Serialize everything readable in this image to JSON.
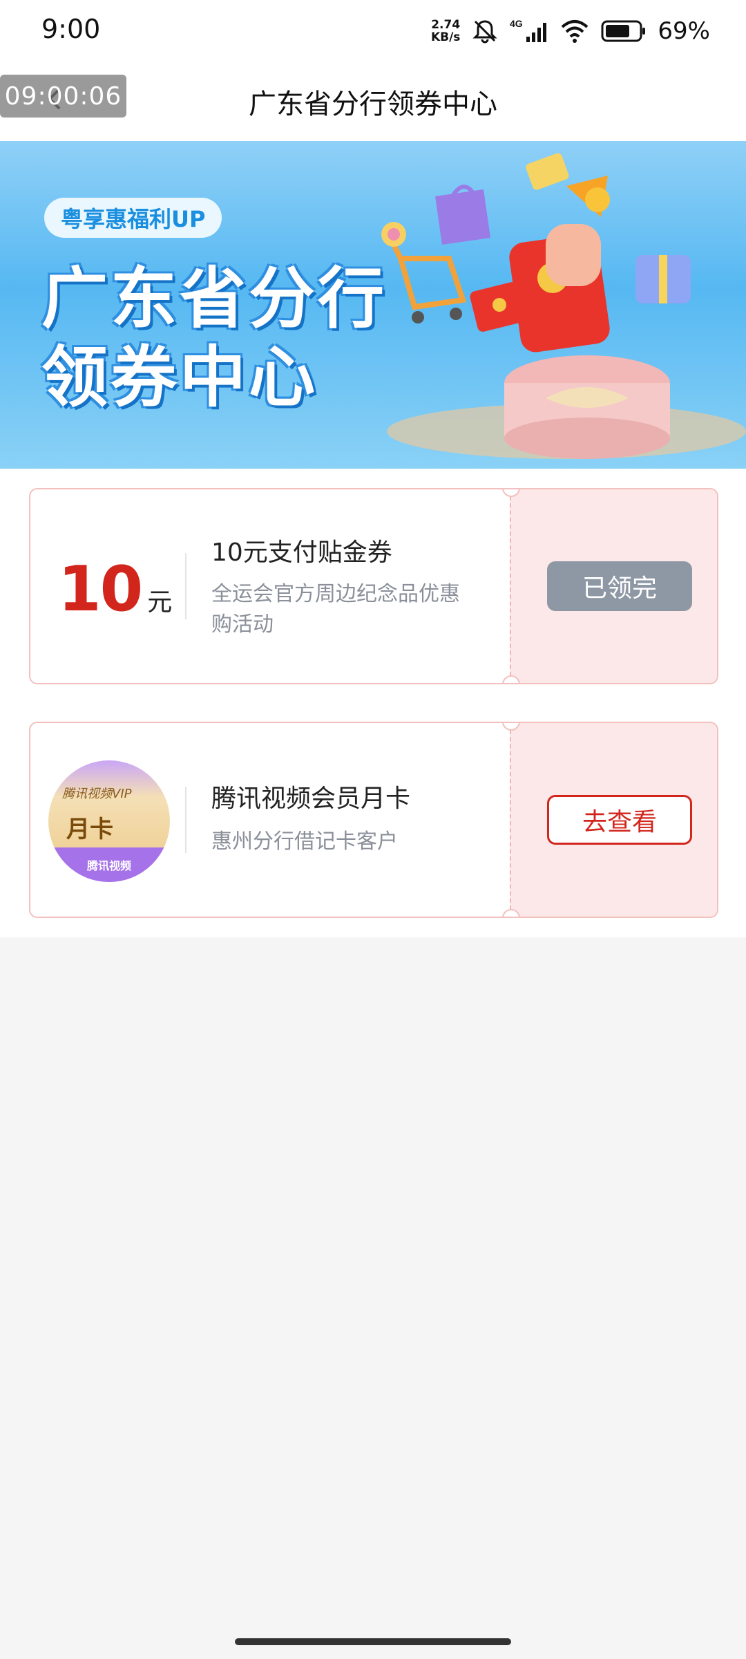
{
  "status_bar": {
    "time": "9:00",
    "net_speed_value": "2.74",
    "net_speed_unit": "KB/s",
    "network_type": "4G",
    "battery_percent": "69%"
  },
  "nav": {
    "timer": "09:00:06",
    "title": "广东省分行领券中心"
  },
  "banner": {
    "tag": "粤享惠福利UP",
    "title_line1": "广东省分行",
    "title_line2": "领券中心"
  },
  "coupons": [
    {
      "amount": "10",
      "unit": "元",
      "title": "10元支付贴金券",
      "desc": "全运会官方周边纪念品优惠购活动",
      "button": "已领完"
    },
    {
      "thumb_brand": "腾讯视频VIP",
      "thumb_label": "月卡",
      "thumb_strip": "腾讯视频",
      "title": "腾讯视频会员月卡",
      "desc": "惠州分行借记卡客户",
      "button": "去查看"
    }
  ],
  "colors": {
    "accent_red": "#d2261d",
    "disabled_gray": "#8e97a4",
    "coupon_pink": "#fce8e8"
  }
}
